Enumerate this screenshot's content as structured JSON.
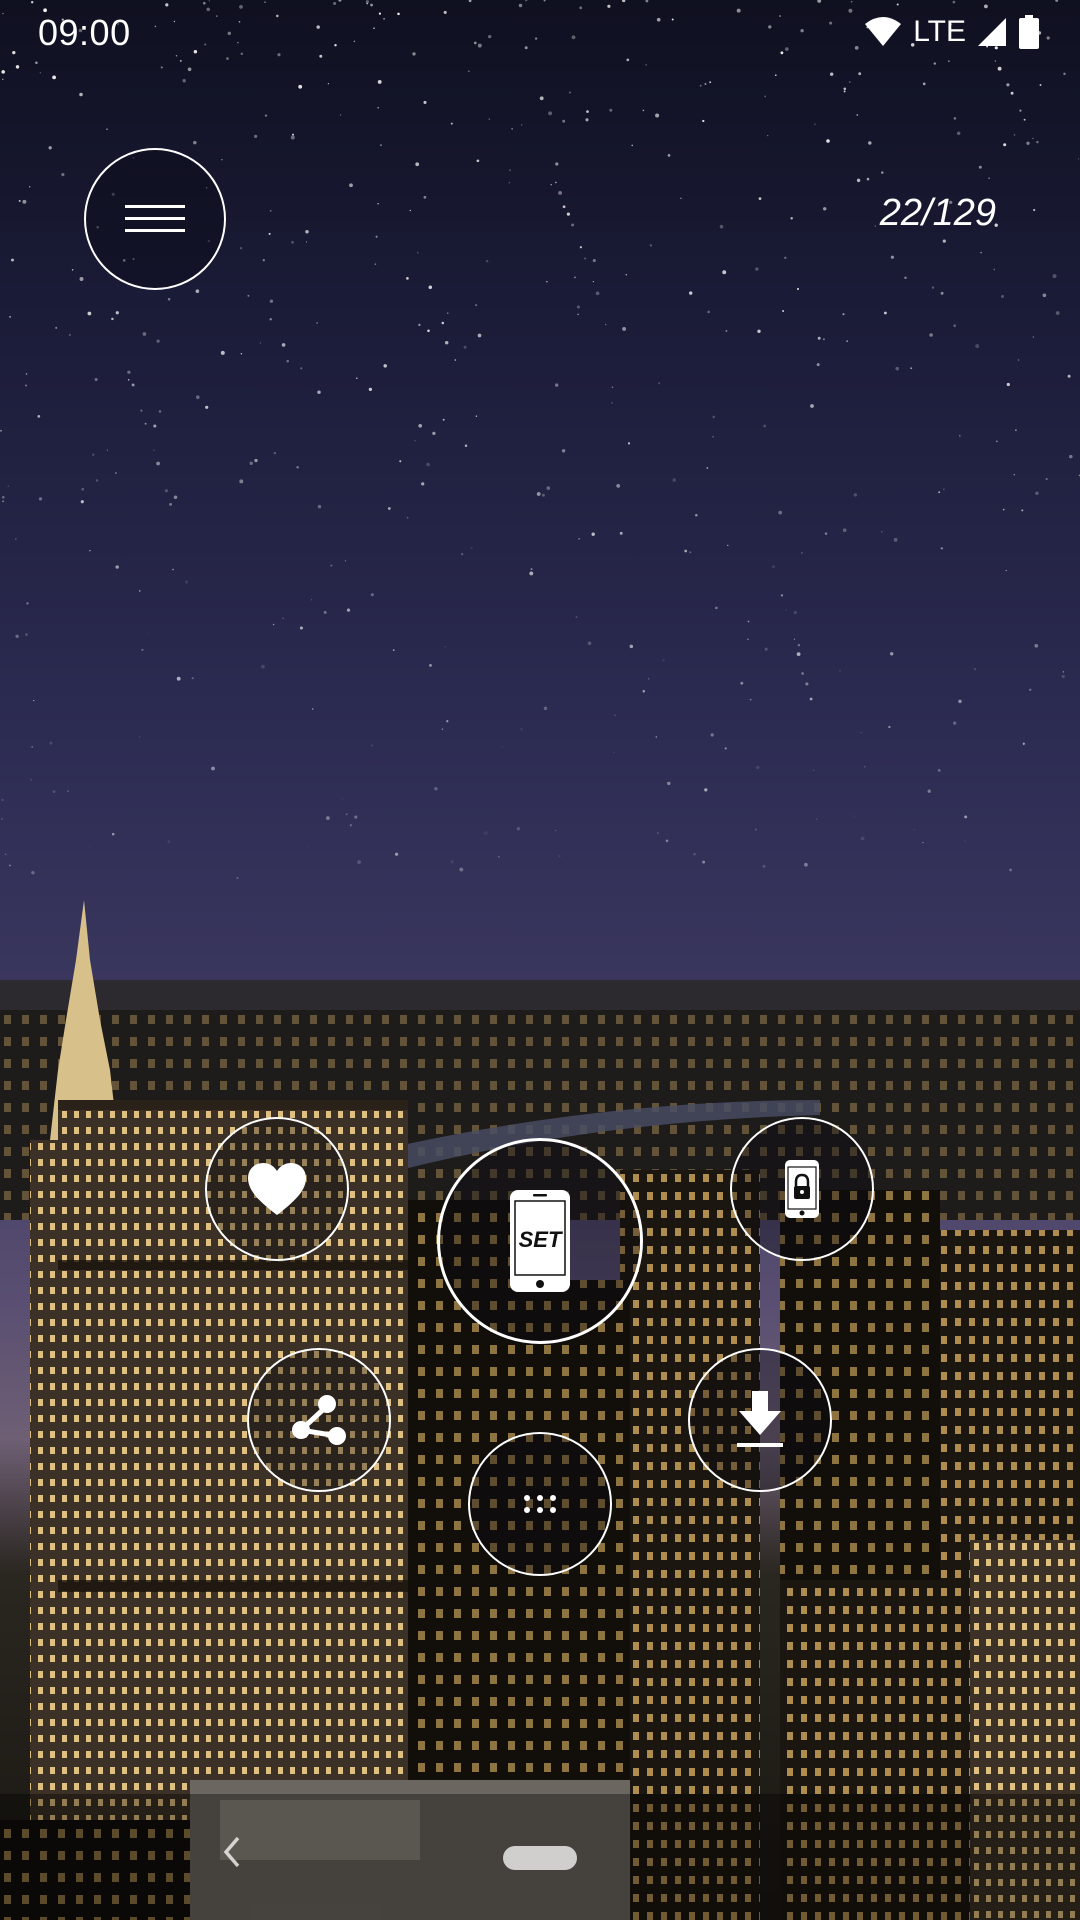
{
  "status_bar": {
    "time": "09:00",
    "network": "LTE",
    "icons": [
      "wifi-icon",
      "cell-signal-icon",
      "battery-icon"
    ]
  },
  "header": {
    "menu_icon": "hamburger-menu-icon",
    "counter": "22/129"
  },
  "actions": [
    {
      "name": "favorite",
      "icon": "heart-icon"
    },
    {
      "name": "set-wallpaper",
      "icon": "phone-set-icon",
      "label": "SET"
    },
    {
      "name": "lock-screen",
      "icon": "phone-lock-icon"
    },
    {
      "name": "share",
      "icon": "share-icon"
    },
    {
      "name": "more",
      "icon": "dots-grid-icon"
    },
    {
      "name": "download",
      "icon": "download-icon"
    }
  ],
  "nav_bar": {
    "icons": [
      "back-chevron-icon",
      "home-pill-icon"
    ]
  },
  "colors": {
    "foreground": "#ffffff",
    "sky_top": "#0f1020",
    "sky_horizon": "#6e5f74"
  }
}
